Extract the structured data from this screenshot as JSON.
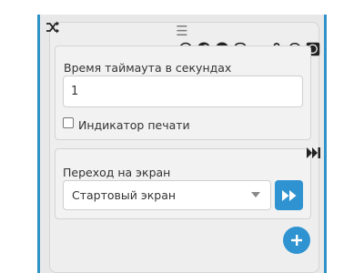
{
  "node": {
    "shuffle_icon": "shuffle-icon",
    "drag_icon": "drag-handle-icon",
    "social_icons": [
      "clock-icon",
      "facebook-icon",
      "telegram-icon",
      "viber-icon",
      "vk-icon",
      "odnoklassniki-icon",
      "whatsapp-icon",
      "whatsapp-business-icon"
    ],
    "timeout": {
      "label": "Время таймаута в секундах",
      "value": "1"
    },
    "typing_indicator": {
      "label": "Индикатор печати",
      "checked": false
    },
    "transition": {
      "label": "Переход на экран",
      "selected": "Стартовый экран"
    },
    "section_arrow_icon": "fast-forward-end-icon",
    "go_icon": "fast-forward-icon",
    "add_icon": "plus-icon"
  },
  "colors": {
    "accent": "#2f93d1",
    "panel_border": "#2f93c8",
    "background": "#e8e8e8"
  }
}
